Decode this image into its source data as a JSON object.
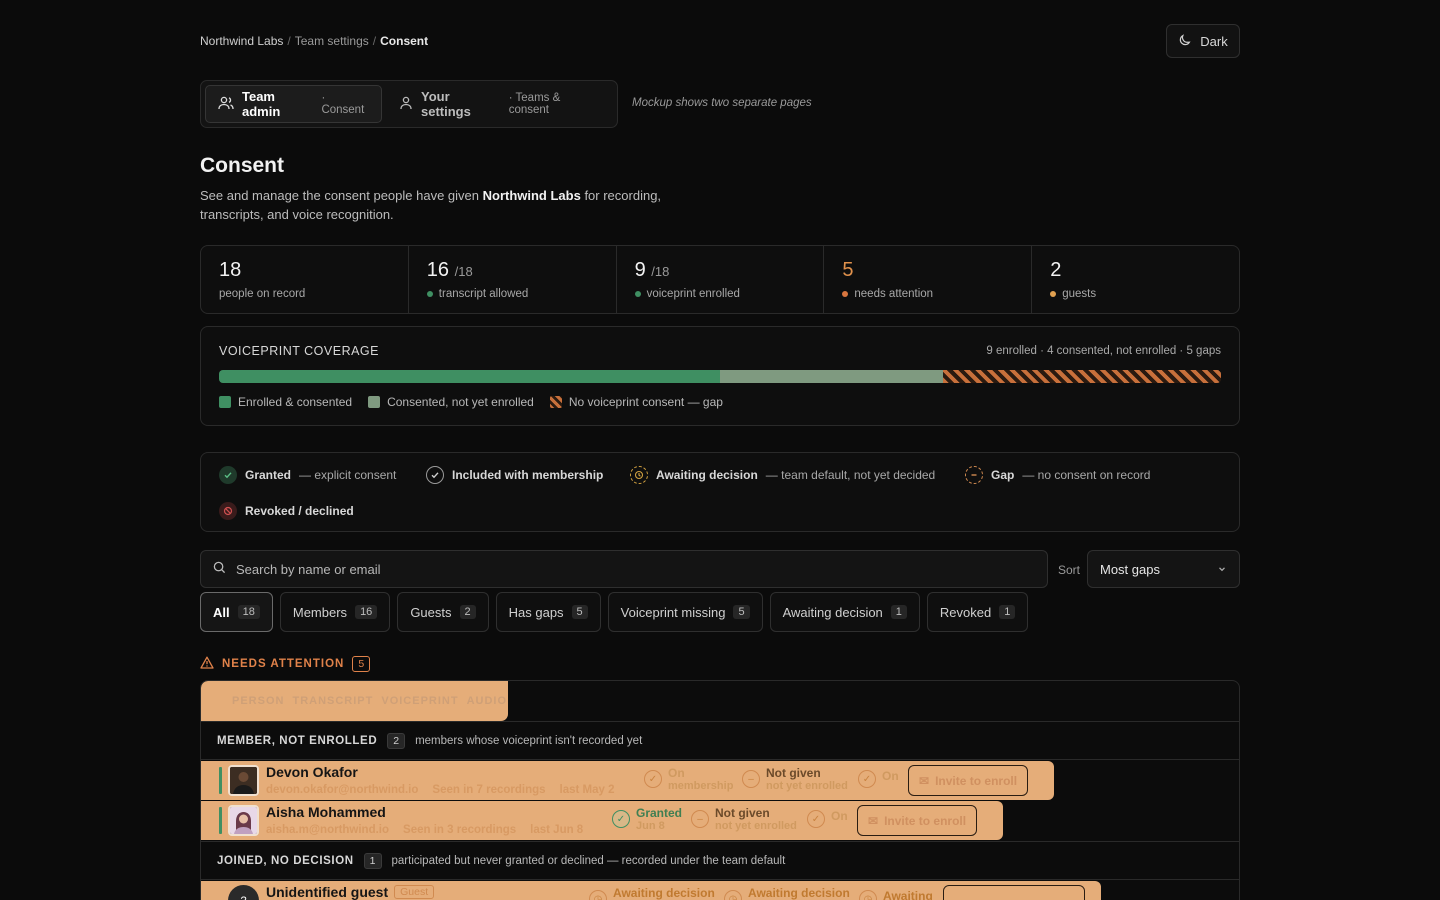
{
  "breadcrumb": {
    "org": "Northwind Labs",
    "section": "Team settings",
    "current": "Consent"
  },
  "theme_button": {
    "label": "Dark"
  },
  "view_switch": {
    "tabs": [
      {
        "label": "Team admin",
        "sub": "· Consent"
      },
      {
        "label": "Your settings",
        "sub": "· Teams & consent"
      }
    ],
    "note": "Mockup shows two separate pages"
  },
  "page": {
    "title": "Consent",
    "desc_pre": "See and manage the consent people have given ",
    "desc_org": "Northwind Labs",
    "desc_post": " for recording, transcripts, and voice recognition."
  },
  "stats": [
    {
      "num": "18",
      "of": "",
      "label": "people on record",
      "dot": ""
    },
    {
      "num": "16",
      "of": "/18",
      "label": "transcript allowed",
      "dot": "#3f8f62"
    },
    {
      "num": "9",
      "of": "/18",
      "label": "voiceprint enrolled",
      "dot": "#3f8f62"
    },
    {
      "num": "5",
      "of": "",
      "label": "needs attention",
      "dot": "#d9763f"
    },
    {
      "num": "2",
      "of": "",
      "label": "guests",
      "dot": "#e0a050"
    }
  ],
  "coverage": {
    "title": "VOICEPRINT COVERAGE",
    "summary": "9 enrolled · 4 consented, not enrolled · 5 gaps",
    "enrolled": 9,
    "consented": 4,
    "gaps": 5,
    "legend": [
      "Enrolled & consented",
      "Consented, not yet enrolled",
      "No voiceprint consent — gap"
    ],
    "colors": {
      "enrolled": "#3f8f62",
      "consented": "#7f9a80",
      "gap": "#c8703b"
    }
  },
  "status_key": [
    {
      "label": "Granted",
      "desc": "— explicit consent",
      "icon": "check-icon"
    },
    {
      "label": "Included with membership",
      "desc": "",
      "icon": "check-outline-icon"
    },
    {
      "label": "Awaiting decision",
      "desc": "— team default, not yet decided",
      "icon": "clock-icon"
    },
    {
      "label": "Gap",
      "desc": "— no consent on record",
      "icon": "minus-icon"
    },
    {
      "label": "Revoked / declined",
      "desc": "",
      "icon": "ban-icon"
    }
  ],
  "search": {
    "placeholder": "Search by name or email"
  },
  "sort": {
    "label": "Sort",
    "value": "Most gaps"
  },
  "filters": [
    {
      "label": "All",
      "count": "18"
    },
    {
      "label": "Members",
      "count": "16"
    },
    {
      "label": "Guests",
      "count": "2"
    },
    {
      "label": "Has gaps",
      "count": "5"
    },
    {
      "label": "Voiceprint missing",
      "count": "5"
    },
    {
      "label": "Awaiting decision",
      "count": "1"
    },
    {
      "label": "Revoked",
      "count": "1"
    }
  ],
  "needs_attention": {
    "title": "NEEDS ATTENTION",
    "count": "5"
  },
  "table": {
    "headers": [
      "PERSON",
      "TRANSCRIPT",
      "VOICEPRINT",
      "AUDIO"
    ],
    "groups": [
      {
        "title": "MEMBER, NOT ENROLLED",
        "count": "2",
        "desc": "members whose voiceprint isn't recorded yet"
      },
      {
        "title": "JOINED, NO DECISION",
        "count": "1",
        "desc": "participated but never granted or declined — recorded under the team default"
      }
    ],
    "rows": [
      {
        "name": "Devon Okafor",
        "email": "devon.okafor@northwind.io",
        "seen": "Seen in 7 recordings",
        "last": "last May 2",
        "transcript": {
          "t": "On",
          "s": "membership"
        },
        "voiceprint": {
          "t": "Not given",
          "s": "not yet enrolled"
        },
        "audio": {
          "t": "On"
        },
        "action": "Invite to enroll"
      },
      {
        "name": "Aisha Mohammed",
        "email": "aisha.m@northwind.io",
        "seen": "Seen in 3 recordings",
        "last": "last Jun 8",
        "transcript": {
          "t": "Granted",
          "s": "Jun 8"
        },
        "voiceprint": {
          "t": "Not given",
          "s": "not yet enrolled"
        },
        "audio": {
          "t": "On"
        },
        "action": "Invite to enroll"
      },
      {
        "name": "Unidentified guest",
        "tag": "Guest",
        "initial": "?",
        "transcript": {
          "t": "Awaiting decision"
        },
        "voiceprint": {
          "t": "Awaiting decision"
        },
        "audio": {
          "t": "Awaiting"
        }
      }
    ]
  }
}
